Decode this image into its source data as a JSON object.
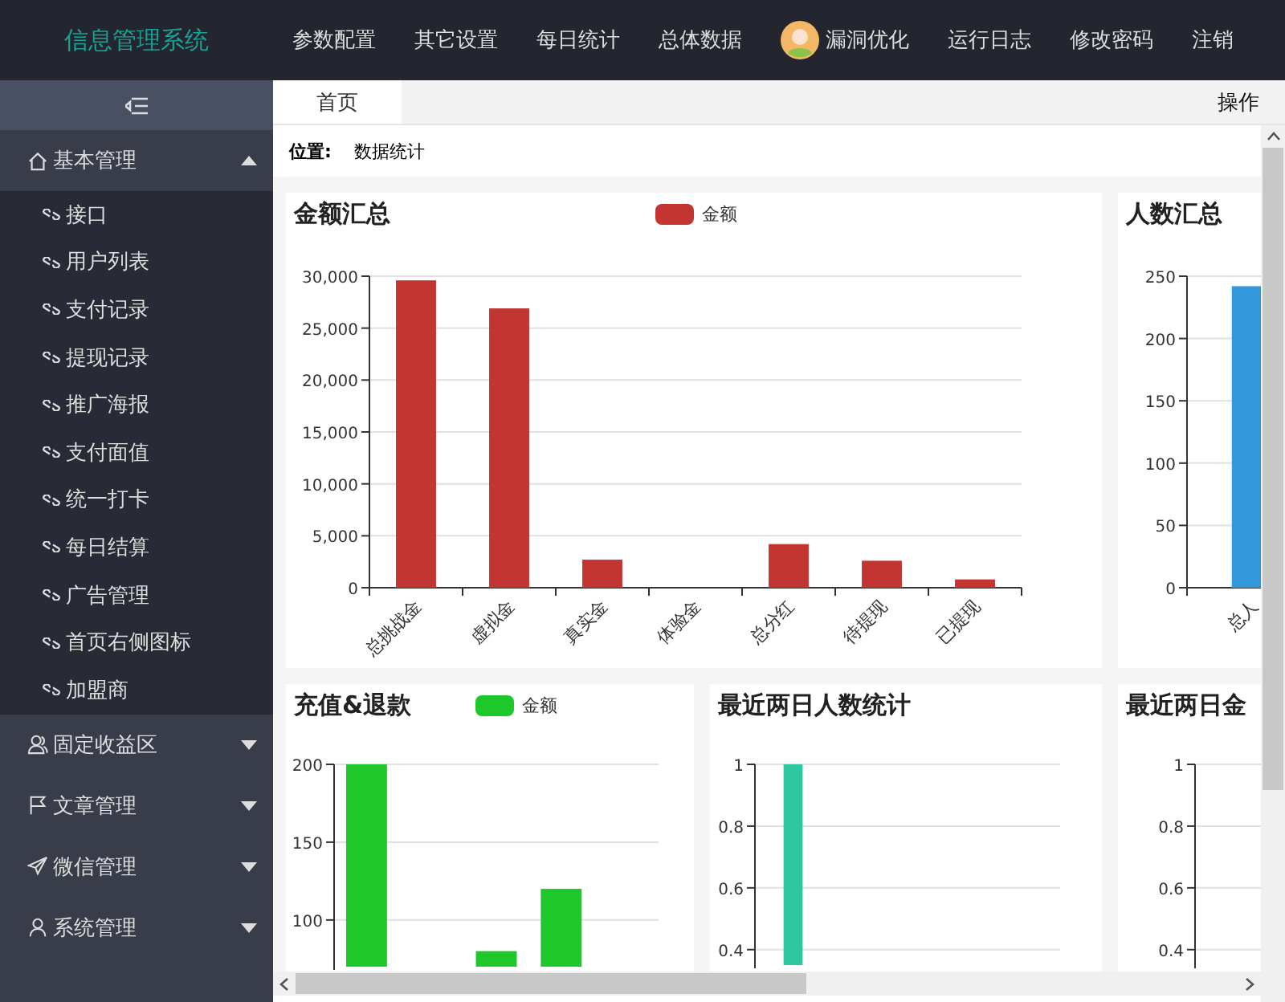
{
  "header": {
    "logo": "信息管理系统",
    "nav": [
      {
        "label": "参数配置",
        "avatar": false
      },
      {
        "label": "其它设置",
        "avatar": false
      },
      {
        "label": "每日统计",
        "avatar": false
      },
      {
        "label": "总体数据",
        "avatar": false
      },
      {
        "label": "漏洞优化",
        "avatar": true
      },
      {
        "label": "运行日志",
        "avatar": false
      },
      {
        "label": "修改密码",
        "avatar": false
      },
      {
        "label": "注销",
        "avatar": false
      }
    ]
  },
  "sidebar": {
    "groups": [
      {
        "label": "基本管理",
        "kind": "home",
        "expanded": true,
        "children": [
          {
            "label": "接口"
          },
          {
            "label": "用户列表"
          },
          {
            "label": "支付记录"
          },
          {
            "label": "提现记录"
          },
          {
            "label": "推广海报"
          },
          {
            "label": "支付面值"
          },
          {
            "label": "统一打卡"
          },
          {
            "label": "每日结算"
          },
          {
            "label": "广告管理"
          },
          {
            "label": "首页右侧图标"
          },
          {
            "label": "加盟商"
          }
        ]
      },
      {
        "label": "固定收益区",
        "kind": "users",
        "expanded": false
      },
      {
        "label": "文章管理",
        "kind": "flag",
        "expanded": false
      },
      {
        "label": "微信管理",
        "kind": "plane",
        "expanded": false
      },
      {
        "label": "系统管理",
        "kind": "user",
        "expanded": false
      }
    ]
  },
  "tabs": [
    {
      "label": "首页",
      "selected": true
    }
  ],
  "tab_actions": "操作",
  "location": {
    "label": "位置:",
    "value": "数据统计"
  },
  "rows": [
    {
      "panels": [
        {
          "chart_data": {
            "type": "bar",
            "grid": true,
            "title": "金额汇总",
            "categories": [
              "总挑战金",
              "虚拟金",
              "真实金",
              "体验金",
              "总分红",
              "待提现",
              "已提现"
            ],
            "series": [
              {
                "name": "金额",
                "color": "#c23531",
                "values": [
                  29600,
                  26900,
                  2700,
                  0,
                  4200,
                  2600,
                  800
                ]
              }
            ],
            "ylim": [
              0,
              30000
            ],
            "yticks": [
              {
                "value": 0,
                "label": "0"
              },
              {
                "value": 5000,
                "label": "5,000"
              },
              {
                "value": 10000,
                "label": "10,000"
              },
              {
                "value": 15000,
                "label": "15,000"
              },
              {
                "value": 20000,
                "label": "20,000"
              },
              {
                "value": 25000,
                "label": "25,000"
              },
              {
                "value": 30000,
                "label": "30,000"
              }
            ]
          }
        },
        {
          "chart_data": {
            "type": "bar",
            "grid": true,
            "title": "人数汇总",
            "categories": [
              "总人"
            ],
            "series": [
              {
                "color": "#3398db",
                "values": [
                  242
                ]
              }
            ],
            "ylim": [
              0,
              250
            ],
            "yticks": [
              0,
              50,
              100,
              150,
              200,
              250
            ]
          }
        }
      ]
    },
    {
      "panels": [
        {
          "chart_data": {
            "type": "bar",
            "grid": true,
            "title": "充值&退款",
            "series": [
              {
                "name": "金额",
                "color": "#1ec72a",
                "values": [
                  200,
                  null,
                  80,
                  120,
                  null
                ]
              }
            ],
            "ylim": [
              70,
              200
            ],
            "yticks": [
              100,
              150,
              200
            ]
          }
        },
        {
          "chart_data": {
            "type": "bar",
            "grid": true,
            "title": "最近两日人数统计",
            "series": [
              {
                "color": "#2ec7a0",
                "values": [
                  1,
                  null,
                  null,
                  null
                ]
              }
            ],
            "ylim": [
              0.35,
              1
            ],
            "yticks": [
              0.4,
              0.6,
              0.8,
              1
            ]
          }
        },
        {
          "chart_data": {
            "type": "bar",
            "grid": true,
            "title": "最近两日金",
            "series": [
              {
                "values": [
                  null,
                  null
                ]
              }
            ],
            "ylim": [
              0.35,
              1
            ],
            "yticks": [
              0.4,
              0.6,
              0.8,
              1
            ]
          }
        }
      ]
    }
  ]
}
